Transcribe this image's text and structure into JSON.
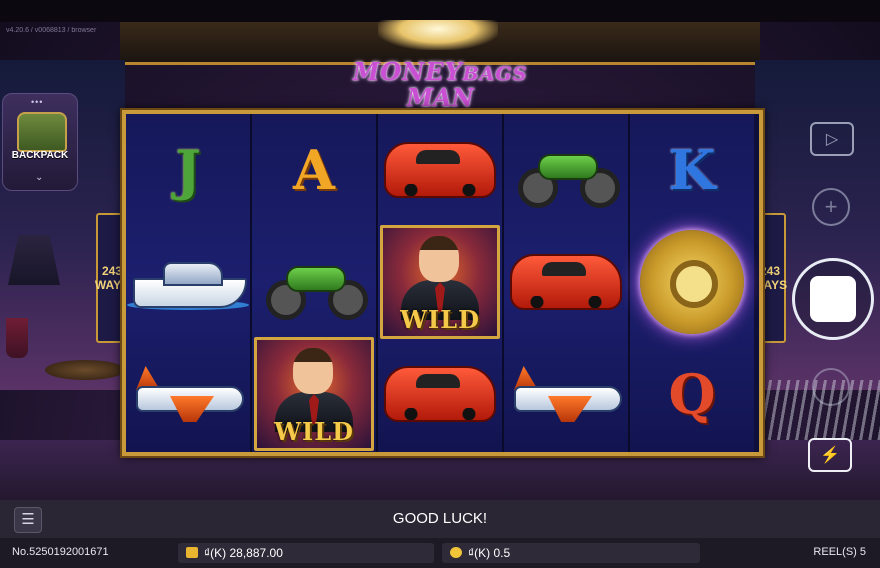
{
  "version": "v4.20.6 / v0068813 / browser",
  "logo": {
    "line1_big": "MONEY",
    "line1_small": "BAGS",
    "line2": "MAN"
  },
  "backpack": {
    "label": "BACKPACK"
  },
  "ways": {
    "number": "243",
    "word": "WAYS"
  },
  "reels": [
    [
      "J",
      "yacht",
      "airplane"
    ],
    [
      "A",
      "motorcycle",
      "wild"
    ],
    [
      "sports-car",
      "wild",
      "sports-car"
    ],
    [
      "motorcycle",
      "sports-car",
      "airplane"
    ],
    [
      "K",
      "vault",
      "Q"
    ]
  ],
  "wild_label": "WILD",
  "status_message": "GOOD LUCK!",
  "bottom": {
    "game_number": "No.5250192001671",
    "balance": "₫(K) 28,887.00",
    "bet": "₫(K) 0.5",
    "reels_count": "REEL(S) 5"
  }
}
